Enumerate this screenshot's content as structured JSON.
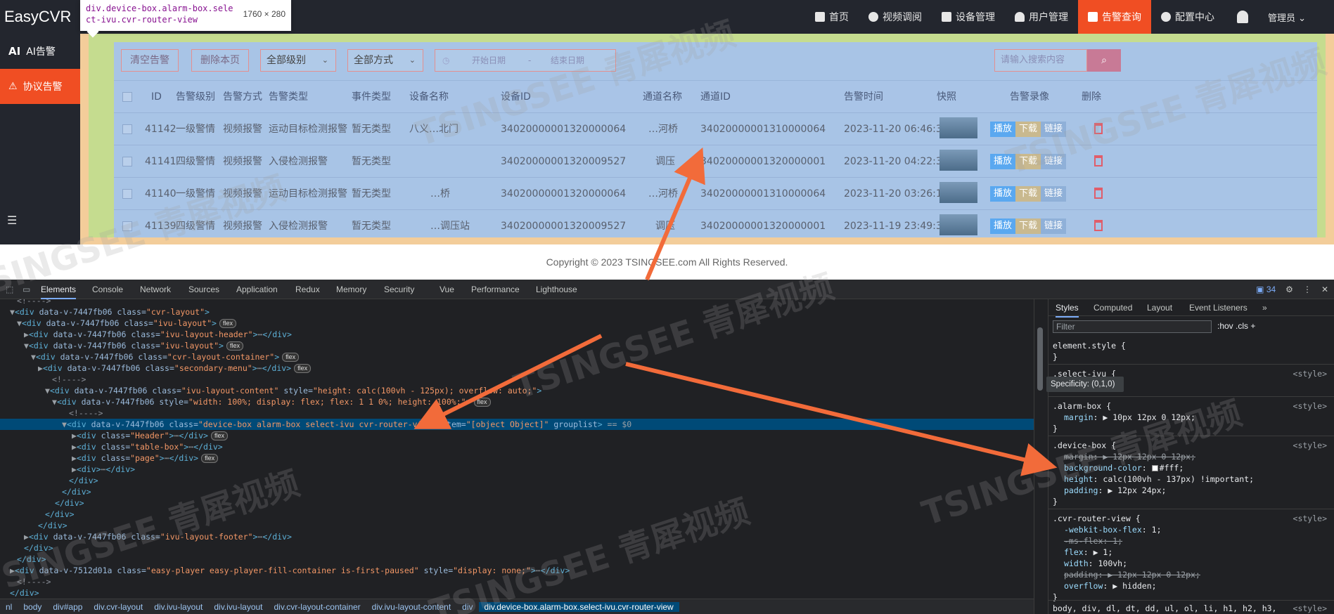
{
  "app": {
    "logo": "EasyCVR",
    "nav": [
      {
        "label": "首页",
        "icon": "dashboard-icon"
      },
      {
        "label": "视频调阅",
        "icon": "play-circle-icon"
      },
      {
        "label": "设备管理",
        "icon": "device-icon"
      },
      {
        "label": "用户管理",
        "icon": "user-icon"
      },
      {
        "label": "告警查询",
        "icon": "alarm-icon",
        "active": true
      },
      {
        "label": "配置中心",
        "icon": "gear-icon"
      }
    ],
    "user": "管理员 ⌄",
    "sidebar": [
      {
        "prefix": "AI",
        "label": "AI告警"
      },
      {
        "prefix": "⚠",
        "label": "协议告警",
        "active": true
      }
    ],
    "sidebar_bottom": "☰"
  },
  "inspect_tooltip": {
    "selector": "div.device-box.alarm-box.select-ivu.cvr-router-view",
    "dims": "1760 × 280"
  },
  "filters": {
    "clear_btn": "清空告警",
    "delete_btn": "删除本页",
    "level_select": "全部级别",
    "method_select": "全部方式",
    "start_placeholder": "开始日期",
    "separator": "-",
    "end_placeholder": "结束日期",
    "search_placeholder": "请输入搜索内容",
    "search_icon": "search-icon"
  },
  "table": {
    "headers": [
      "ID",
      "告警级别",
      "告警方式",
      "告警类型",
      "事件类型",
      "设备名称",
      "设备ID",
      "通道名称",
      "通道ID",
      "告警时间",
      "快照",
      "告警录像",
      "删除"
    ],
    "rows": [
      {
        "id": "41142",
        "level": "一级警情",
        "method": "视频报警",
        "type": "运动目标检测报警",
        "event": "暂无类型",
        "device_name": "八义…北门",
        "device_id": "34020000001320000064",
        "channel_name": "…河桥",
        "channel_id": "34020000001310000064",
        "time": "2023-11-20 06:46:35"
      },
      {
        "id": "41141",
        "level": "四级警情",
        "method": "视频报警",
        "type": "入侵检测报警",
        "event": "暂无类型",
        "device_name": "",
        "device_id": "34020000001320009527",
        "channel_name": "调压",
        "channel_id": "34020000001320000001",
        "time": "2023-11-20 04:22:30"
      },
      {
        "id": "41140",
        "level": "一级警情",
        "method": "视频报警",
        "type": "运动目标检测报警",
        "event": "暂无类型",
        "device_name": "…桥",
        "device_id": "34020000001320000064",
        "channel_name": "…河桥",
        "channel_id": "34020000001310000064",
        "time": "2023-11-20 03:26:19"
      },
      {
        "id": "41139",
        "level": "四级警情",
        "method": "视频报警",
        "type": "入侵检测报警",
        "event": "暂无类型",
        "device_name": "…调压站",
        "device_id": "34020000001320009527",
        "channel_name": "调压",
        "channel_id": "34020000001320000001",
        "time": "2023-11-19 23:49:30"
      }
    ],
    "actions": {
      "play": "播放",
      "download": "下载",
      "link": "链接"
    }
  },
  "footer": "Copyright © 2023 TSINGSEE.com All Rights Reserved.",
  "devtools": {
    "tabs": [
      "Elements",
      "Console",
      "Network",
      "Sources",
      "Application",
      "Redux",
      "Memory",
      "Security",
      "Vue",
      "Performance",
      "Lighthouse"
    ],
    "issues": "34",
    "breadcrumbs": [
      "nl",
      "body",
      "div#app",
      "div.cvr-layout",
      "div.ivu-layout",
      "div.ivu-layout",
      "div.cvr-layout-container",
      "div.ivu-layout-content",
      "div",
      "div.device-box.alarm-box.select-ivu.cvr-router-view"
    ],
    "styles_tabs": [
      "Styles",
      "Computed",
      "Layout",
      "Event Listeners",
      "»"
    ],
    "filter_placeholder": "Filter",
    "hov_cls": ":hov  .cls  +",
    "specificity": "Specificity: (0,1,0)"
  },
  "watermark": "TSINGSEE 青犀视频"
}
